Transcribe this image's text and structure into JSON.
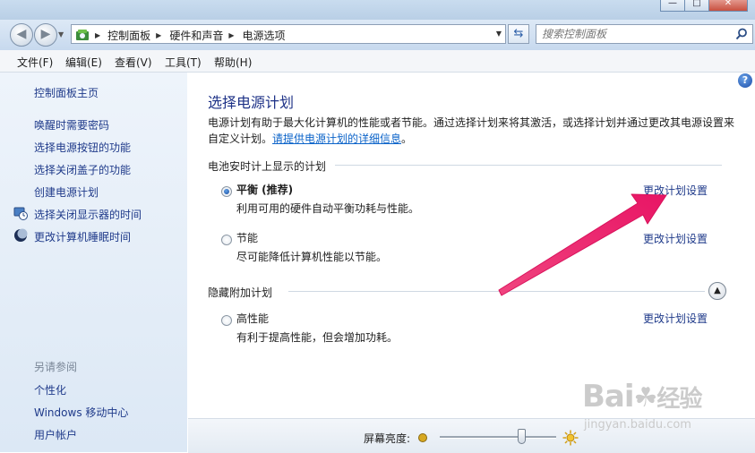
{
  "window": {
    "buttons": [
      "—",
      "□",
      "✕"
    ]
  },
  "address": {
    "crumbs": [
      "控制面板",
      "硬件和声音",
      "电源选项"
    ]
  },
  "search": {
    "placeholder": "搜索控制面板"
  },
  "menu": [
    "文件(F)",
    "编辑(E)",
    "查看(V)",
    "工具(T)",
    "帮助(H)"
  ],
  "sidebar": {
    "home": "控制面板主页",
    "links": [
      {
        "label": "唤醒时需要密码",
        "icon": ""
      },
      {
        "label": "选择电源按钮的功能",
        "icon": ""
      },
      {
        "label": "选择关闭盖子的功能",
        "icon": ""
      },
      {
        "label": "创建电源计划",
        "icon": ""
      },
      {
        "label": "选择关闭显示器的时间",
        "icon": "display-clock-icon"
      },
      {
        "label": "更改计算机睡眠时间",
        "icon": "moon-icon"
      }
    ],
    "see_also_title": "另请参阅",
    "see_also": [
      "个性化",
      "Windows 移动中心",
      "用户帐户"
    ]
  },
  "main": {
    "title": "选择电源计划",
    "description": "电源计划有助于最大化计算机的性能或者节能。通过选择计划来将其激活，或选择计划并通过更改其电源设置来自定义计划。",
    "info_link": "请提供电源计划的详细信息",
    "info_link_suffix": "。",
    "group1_title": "电池安时计上显示的计划",
    "hidden_title": "隐藏附加计划",
    "change_link": "更改计划设置",
    "plans": [
      {
        "name": "平衡 (推荐)",
        "desc": "利用可用的硬件自动平衡功耗与性能。",
        "selected": true
      },
      {
        "name": "节能",
        "desc": "尽可能降低计算机性能以节能。",
        "selected": false
      },
      {
        "name": "高性能",
        "desc": "有利于提高性能，但会增加功耗。",
        "selected": false
      }
    ],
    "brightness_label": "屏幕亮度:",
    "brightness_level": 0.7
  },
  "watermark": {
    "brand": "Bai",
    "brand2": "经验",
    "url": "jingyan.baidu.com"
  },
  "colors": {
    "link": "#1f3a8a",
    "title": "#1e3287",
    "arrow": "#ee1f6d",
    "side_bg": "#e6eef8"
  }
}
